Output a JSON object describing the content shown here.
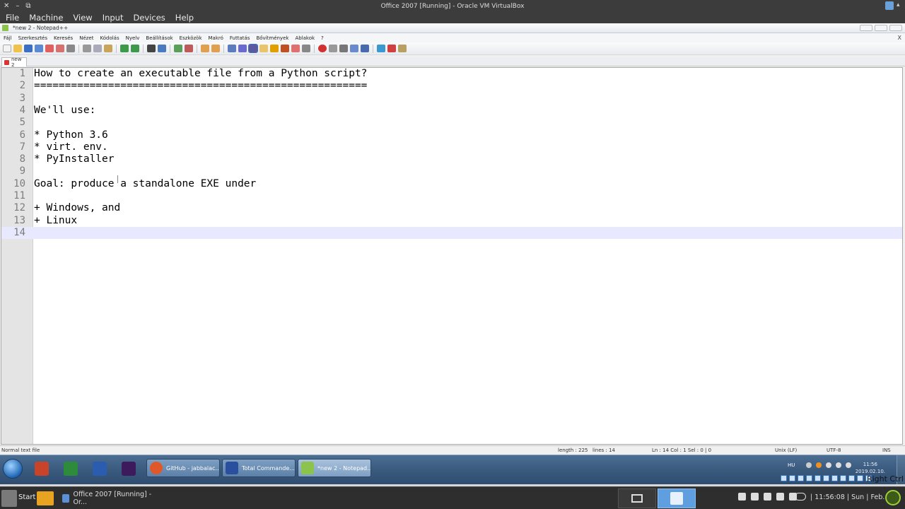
{
  "vbox": {
    "title": "Office 2007 [Running] - Oracle VM VirtualBox",
    "window_controls": [
      "✕",
      "–",
      "⧉"
    ],
    "menu": [
      "File",
      "Machine",
      "View",
      "Input",
      "Devices",
      "Help"
    ],
    "right_ctrl": "Right Ctrl"
  },
  "npp": {
    "title": "*new 2 - Notepad++",
    "menu": [
      "Fájl",
      "Szerkesztés",
      "Keresés",
      "Nézet",
      "Kódolás",
      "Nyelv",
      "Beállítások",
      "Eszközök",
      "Makró",
      "Futtatás",
      "Bővítmények",
      "Ablakok",
      "?"
    ],
    "menu_close": "X",
    "tab_label": "new 2",
    "lines": [
      {
        "n": "1",
        "text": "How to create an executable file from a Python script?"
      },
      {
        "n": "2",
        "text": "======================================================"
      },
      {
        "n": "3",
        "text": ""
      },
      {
        "n": "4",
        "text": "We'll use:"
      },
      {
        "n": "5",
        "text": ""
      },
      {
        "n": "6",
        "text": "* Python 3.6"
      },
      {
        "n": "7",
        "text": "* virt. env."
      },
      {
        "n": "8",
        "text": "* PyInstaller"
      },
      {
        "n": "9",
        "text": ""
      },
      {
        "n": "10",
        "text": "Goal: produce a standalone EXE under"
      },
      {
        "n": "11",
        "text": ""
      },
      {
        "n": "12",
        "text": "+ Windows, and"
      },
      {
        "n": "13",
        "text": "+ Linux"
      },
      {
        "n": "14",
        "text": ""
      }
    ],
    "current_line": 14,
    "status": {
      "filetype": "Normal text file",
      "length": "length : 225",
      "lines": "lines : 14",
      "position": "Ln : 14    Col : 1    Sel : 0 | 0",
      "eol": "Unix (LF)",
      "encoding": "UTF-8",
      "mode": "INS"
    }
  },
  "win_taskbar": {
    "tasks": [
      {
        "label": "GitHub - jabbalac...",
        "color": "#e0582a"
      },
      {
        "label": "Total Commande...",
        "color": "#2a4f9e"
      },
      {
        "label": "*new 2 - Notepad...",
        "color": "#8cc34a"
      }
    ],
    "pinned_colors": [
      "#c7432a",
      "#2f8b3c",
      "#2a5db0",
      "#3d1a5c"
    ],
    "lang": "HU",
    "time": "11:56",
    "date": "2019.02.10."
  },
  "host": {
    "start_label": "Start",
    "task_label": "Office 2007 [Running] - Or...",
    "clock": "| 11:56:08 | Sun | Feb. 10"
  }
}
